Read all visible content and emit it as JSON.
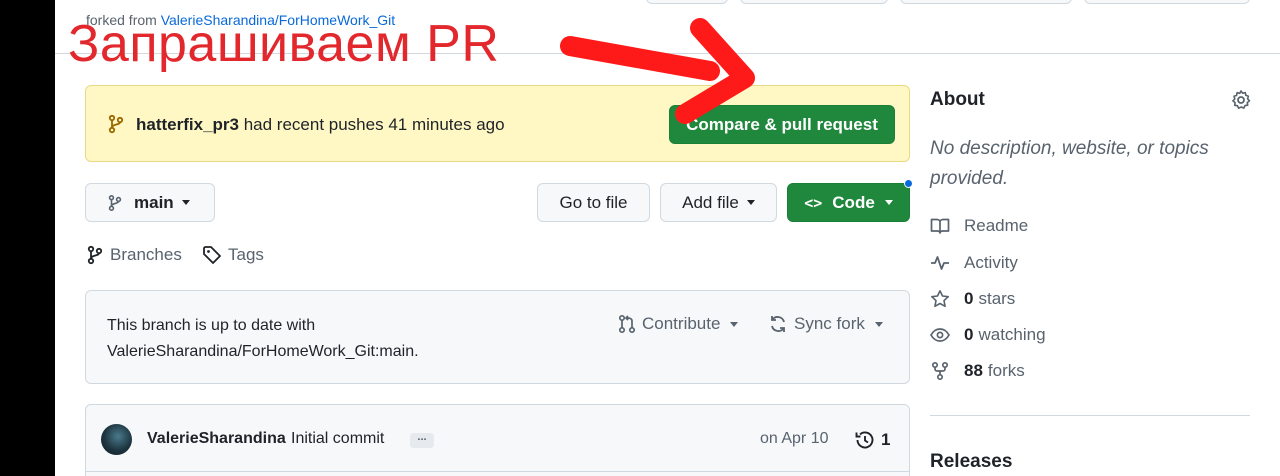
{
  "header": {
    "forked_prefix": "forked from",
    "forked_repo": "ValerieSharandina/ForHomeWork_Git"
  },
  "annotation": {
    "text": "Запрашиваем PR",
    "color": "#e2282d"
  },
  "banner": {
    "branch": "hatterfix_pr3",
    "message": "had recent pushes 41 minutes ago",
    "button": "Compare & pull request"
  },
  "toolbar": {
    "branch": "main",
    "go_to_file": "Go to file",
    "add_file": "Add file",
    "code": "Code"
  },
  "meta": {
    "branches": "Branches",
    "tags": "Tags"
  },
  "sync": {
    "line1": "This branch is up to date with",
    "line2": "ValerieSharandina/ForHomeWork_Git:main.",
    "contribute": "Contribute",
    "sync_fork": "Sync fork"
  },
  "commit": {
    "author": "ValerieSharandina",
    "message": "Initial commit",
    "ellipsis": "...",
    "date": "on Apr 10",
    "count": "1"
  },
  "about": {
    "title": "About",
    "description": "No description, website, or topics provided.",
    "readme": "Readme",
    "activity": "Activity",
    "stars_count": "0",
    "stars_label": "stars",
    "watching_count": "0",
    "watching_label": "watching",
    "forks_count": "88",
    "forks_label": "forks"
  },
  "releases": {
    "title": "Releases"
  },
  "colors": {
    "primary_green": "#1f883d",
    "banner_bg": "#fff8c5",
    "link_blue": "#0969da"
  }
}
